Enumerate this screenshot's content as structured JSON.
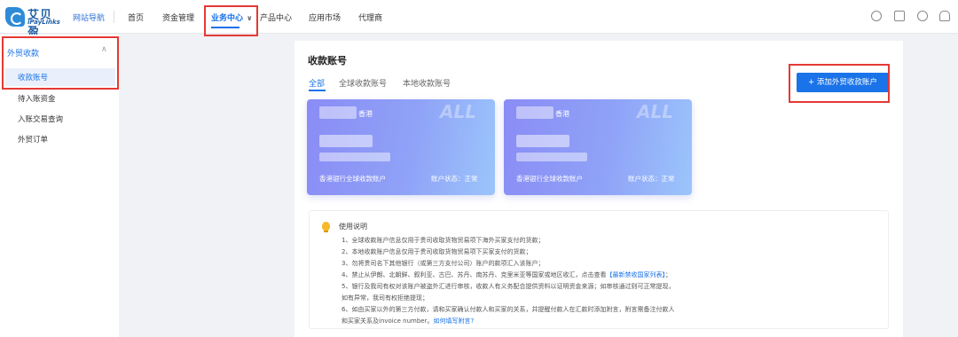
{
  "logo": {
    "cn": "艾贝盈",
    "en": "iPayLinks"
  },
  "header": {
    "site_nav": "网站导航",
    "nav": [
      "首页",
      "资金管理",
      "业务中心",
      "产品中心",
      "应用市场",
      "代理商"
    ]
  },
  "sidebar": {
    "group": "外贸收款",
    "items": [
      "收款账号",
      "待入账资金",
      "入账交易查询",
      "外贸订单"
    ]
  },
  "main": {
    "title": "收款账号",
    "tabs": [
      "全部",
      "全球收款账号",
      "本地收款账号"
    ],
    "add_button": "+ 添加外贸收款账户",
    "cards": [
      {
        "region": "香港",
        "watermark": "ALL",
        "name": "香港银行全球收款账户",
        "status": "账户状态：正常"
      },
      {
        "region": "香港",
        "watermark": "ALL",
        "name": "香港银行全球收款账户",
        "status": "账户状态：正常"
      }
    ],
    "notice": {
      "title": "使用说明",
      "l1": "1、全球收款账户信息仅用于贵司收取货物贸易项下海外买家支付的货款；",
      "l2": "2、本地收款账户信息仅用于贵司收取货物贸易项下买家支付的货款；",
      "l3": "3、勿将贵司名下其他银行（或第三方支付公司）账户的款项汇入该账户；",
      "l4_pre": "4、禁止从伊朗、北朝鲜、叙利亚、古巴、苏丹、南苏丹、克里米亚等国家或地区收汇，点击查看",
      "l4_link": "【最新禁收国家列表】",
      "l4_post": "；",
      "l5": "5、银行及我司有权对该账户被盗外汇进行审核，收款人有义务配合提供资料以证明资金来源；如审核通过则可正常提现，",
      "l5b": "如有异常，我司有权拒绝提现；",
      "l6": "6、如由买家以外的第三方付款，请和买家确认付款人和买家的关系，并提醒付款人在汇款时添加附言，附言需备注付款人",
      "l6b_pre": "和买家关系及invoice number。",
      "l6b_link": "如何填写附言?"
    }
  }
}
